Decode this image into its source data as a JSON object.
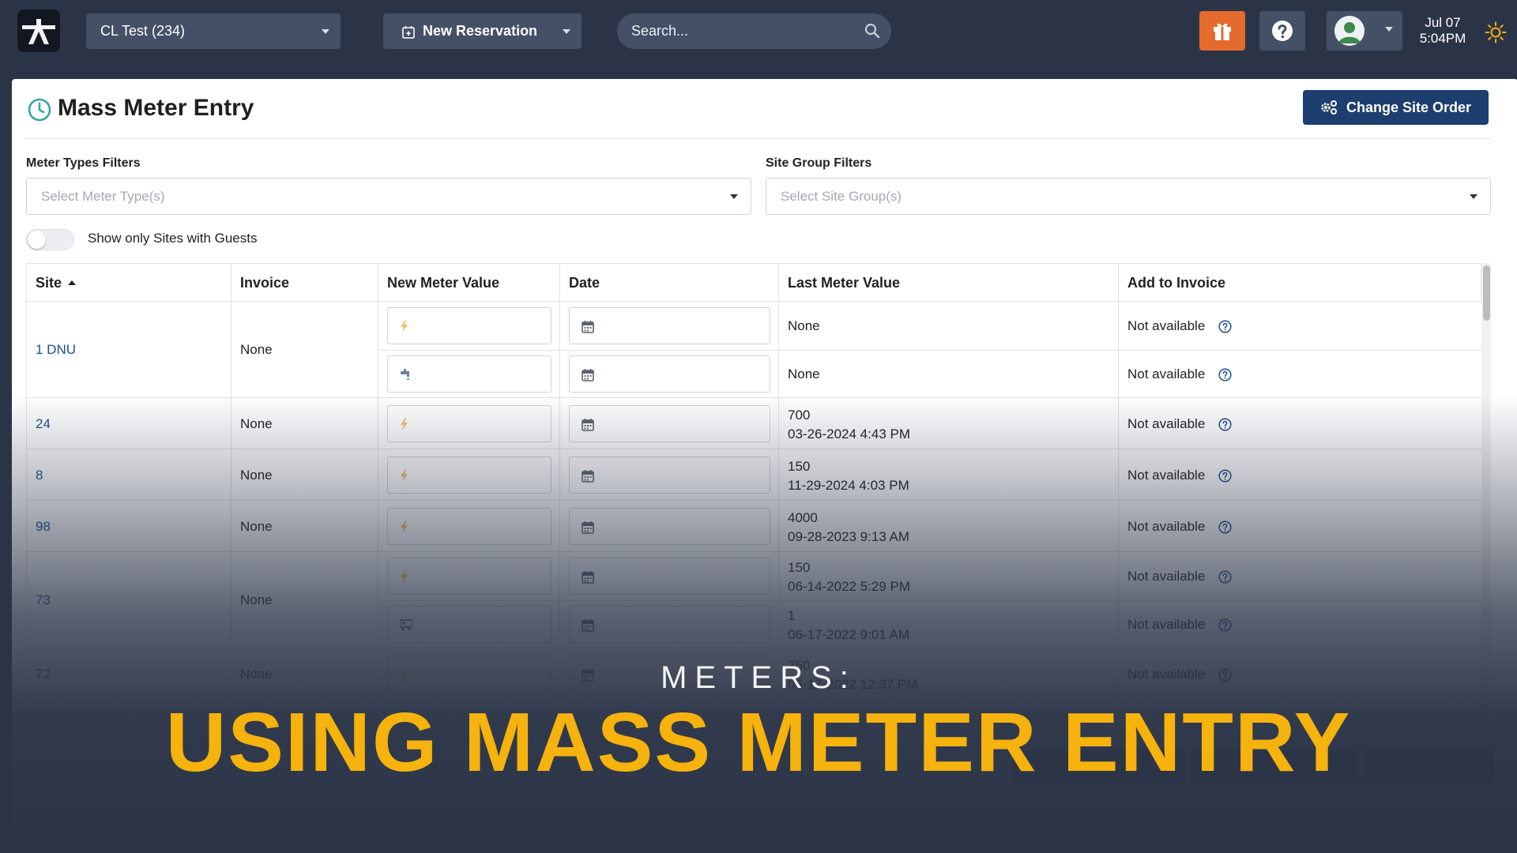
{
  "topbar": {
    "park_select": "CL Test (234)",
    "new_reservation": "New Reservation",
    "search_placeholder": "Search...",
    "date": "Jul 07",
    "time": "5:04PM"
  },
  "page": {
    "title": "Mass Meter Entry",
    "change_site_order": "Change Site Order"
  },
  "filters": {
    "meter_types_label": "Meter Types Filters",
    "meter_types_placeholder": "Select Meter Type(s)",
    "site_group_label": "Site Group Filters",
    "site_group_placeholder": "Select Site Group(s)",
    "toggle_label": "Show only Sites with Guests"
  },
  "table": {
    "columns": [
      "Site",
      "Invoice",
      "New Meter Value",
      "Date",
      "Last Meter Value",
      "Add to Invoice"
    ],
    "rows": [
      {
        "site": "1 DNU",
        "invoice": "None",
        "meters": [
          {
            "icon": "lightning-icon",
            "last_value": "None",
            "last_date": "",
            "add": "Not available"
          },
          {
            "icon": "water-faucet-icon",
            "last_value": "None",
            "last_date": "",
            "add": "Not available"
          }
        ]
      },
      {
        "site": "24",
        "invoice": "None",
        "meters": [
          {
            "icon": "lightning-icon",
            "last_value": "700",
            "last_date": "03-26-2024 4:43 PM",
            "add": "Not available"
          }
        ]
      },
      {
        "site": "8",
        "invoice": "None",
        "meters": [
          {
            "icon": "lightning-icon",
            "last_value": "150",
            "last_date": "11-29-2024 4:03 PM",
            "add": "Not available"
          }
        ]
      },
      {
        "site": "98",
        "invoice": "None",
        "meters": [
          {
            "icon": "lightning-icon",
            "last_value": "4000",
            "last_date": "09-28-2023 9:13 AM",
            "add": "Not available"
          }
        ]
      },
      {
        "site": "73",
        "invoice": "None",
        "meters": [
          {
            "icon": "lightning-icon",
            "last_value": "150",
            "last_date": "06-14-2022 5:29 PM",
            "add": "Not available"
          },
          {
            "icon": "rv-icon",
            "last_value": "1",
            "last_date": "06-17-2022 9:01 AM",
            "add": "Not available"
          }
        ]
      },
      {
        "site": "72",
        "invoice": "None",
        "meters": [
          {
            "icon": "lightning-icon",
            "last_value": "250",
            "last_date": "06-17-2022 12:37 PM",
            "add": "Not available"
          }
        ]
      }
    ]
  },
  "banner": {
    "subtitle": "METERS:",
    "title": "USING MASS METER ENTRY"
  },
  "colors": {
    "navbar": "#2b3447",
    "accent_orange": "#e56a2e",
    "primary_button": "#1d3e6e",
    "banner_title": "#f6b20d",
    "link": "#1d4f91"
  }
}
